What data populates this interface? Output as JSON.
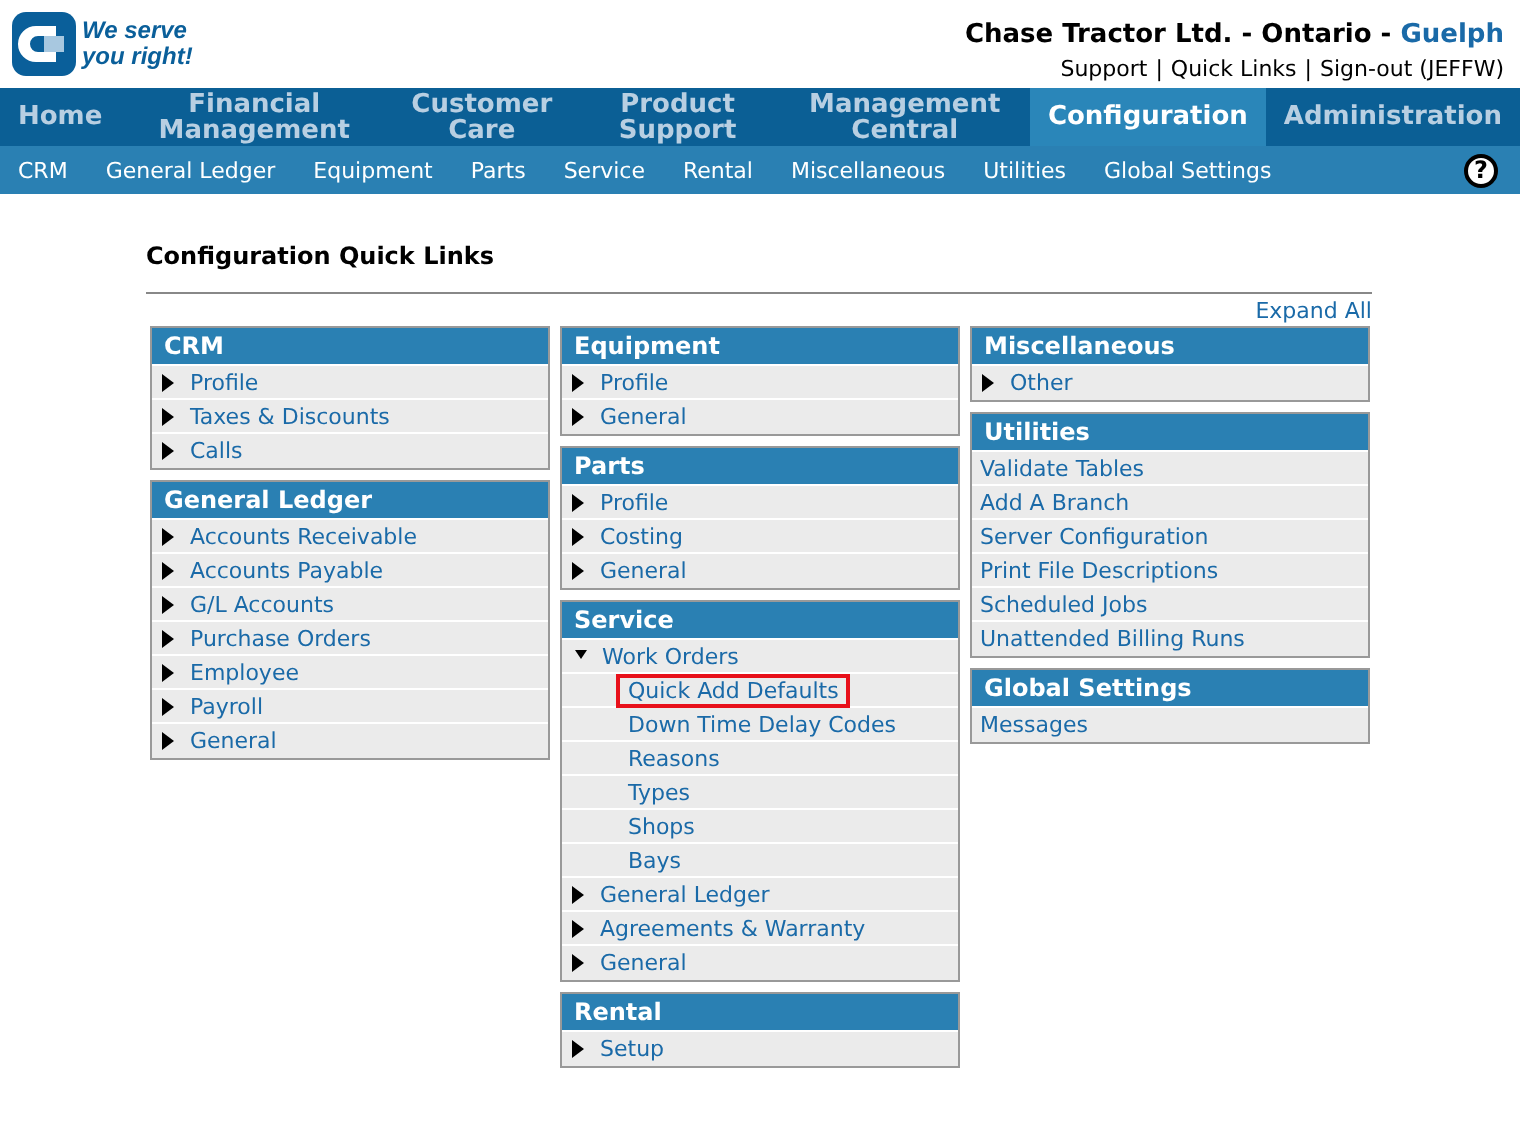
{
  "header": {
    "logo_text": [
      "We serve",
      "you right!"
    ],
    "company": "Chase Tractor Ltd. - Ontario - ",
    "branch": "Guelph",
    "links": [
      "Support",
      "Quick Links",
      "Sign-out (JEFFW)"
    ],
    "separator": "|"
  },
  "main_nav": [
    {
      "label": "Home",
      "selected": false
    },
    {
      "label": "Financial Management",
      "selected": false
    },
    {
      "label": "Customer Care",
      "selected": false
    },
    {
      "label": "Product Support",
      "selected": false
    },
    {
      "label": "Management Central",
      "selected": false
    },
    {
      "label": "Configuration",
      "selected": true
    },
    {
      "label": "Administration",
      "selected": false
    }
  ],
  "sub_nav": [
    "CRM",
    "General Ledger",
    "Equipment",
    "Parts",
    "Service",
    "Rental",
    "Miscellaneous",
    "Utilities",
    "Global Settings"
  ],
  "help": "?",
  "page_title": "Configuration Quick Links",
  "expand_all": "Expand All",
  "columns": [
    [
      {
        "title": "CRM",
        "items": [
          {
            "label": "Profile",
            "kind": "link"
          },
          {
            "label": "Taxes & Discounts",
            "kind": "link"
          },
          {
            "label": "Calls",
            "kind": "link"
          }
        ]
      },
      {
        "title": "General Ledger",
        "items": [
          {
            "label": "Accounts Receivable",
            "kind": "link"
          },
          {
            "label": "Accounts Payable",
            "kind": "link"
          },
          {
            "label": "G/L Accounts",
            "kind": "link"
          },
          {
            "label": "Purchase Orders",
            "kind": "link"
          },
          {
            "label": "Employee",
            "kind": "link"
          },
          {
            "label": "Payroll",
            "kind": "link"
          },
          {
            "label": "General",
            "kind": "link"
          }
        ]
      }
    ],
    [
      {
        "title": "Equipment",
        "items": [
          {
            "label": "Profile",
            "kind": "link"
          },
          {
            "label": "General",
            "kind": "link"
          }
        ]
      },
      {
        "title": "Parts",
        "items": [
          {
            "label": "Profile",
            "kind": "link"
          },
          {
            "label": "Costing",
            "kind": "link"
          },
          {
            "label": "General",
            "kind": "link"
          }
        ]
      },
      {
        "title": "Service",
        "items": [
          {
            "label": "Work Orders",
            "kind": "link",
            "expanded": true,
            "children": [
              {
                "label": "Quick Add Defaults",
                "highlighted": true
              },
              {
                "label": "Down Time Delay Codes",
                "highlighted": false
              },
              {
                "label": "Reasons",
                "highlighted": false
              },
              {
                "label": "Types",
                "highlighted": false
              },
              {
                "label": "Shops",
                "highlighted": false
              },
              {
                "label": "Bays",
                "highlighted": false
              }
            ]
          },
          {
            "label": "General Ledger",
            "kind": "link",
            "expanded": false
          },
          {
            "label": "Agreements & Warranty",
            "kind": "link",
            "expanded": false
          },
          {
            "label": "General",
            "kind": "link",
            "expanded": false
          }
        ]
      },
      {
        "title": "Rental",
        "items": [
          {
            "label": "Setup",
            "kind": "link"
          }
        ]
      }
    ],
    [
      {
        "title": "Miscellaneous",
        "items": [
          {
            "label": "Other",
            "kind": "link"
          }
        ]
      },
      {
        "title": "Utilities",
        "items": [
          {
            "label": "Validate Tables",
            "kind": "plain"
          },
          {
            "label": "Add A Branch",
            "kind": "plain"
          },
          {
            "label": "Server Configuration",
            "kind": "plain"
          },
          {
            "label": "Print File Descriptions",
            "kind": "plain"
          },
          {
            "label": "Scheduled Jobs",
            "kind": "plain"
          },
          {
            "label": "Unattended Billing Runs",
            "kind": "plain"
          }
        ]
      },
      {
        "title": "Global Settings",
        "items": [
          {
            "label": "Messages",
            "kind": "plain"
          }
        ]
      }
    ]
  ]
}
